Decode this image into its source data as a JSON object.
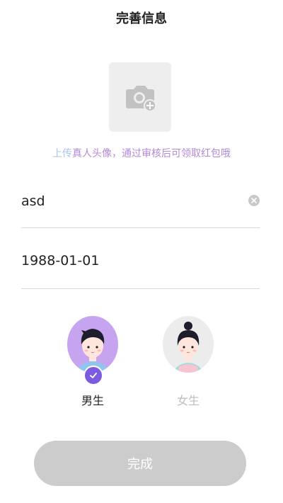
{
  "header": {
    "title": "完善信息"
  },
  "avatar_upload": {
    "icon": "camera-add-icon",
    "hint_lead": "上传",
    "hint_rest": "真人头像，通过审核后可领取红包哦"
  },
  "form": {
    "name_value": "asd",
    "birthdate_value": "1988-01-01"
  },
  "gender": {
    "male_label": "男生",
    "female_label": "女生",
    "selected": "male"
  },
  "submit": {
    "label": "完成"
  },
  "colors": {
    "accent": "#7b5ce0",
    "male_avatar_bg": "#c6a4f0",
    "hint_text": "#b08ad8",
    "button_disabled": "#cccccc"
  }
}
